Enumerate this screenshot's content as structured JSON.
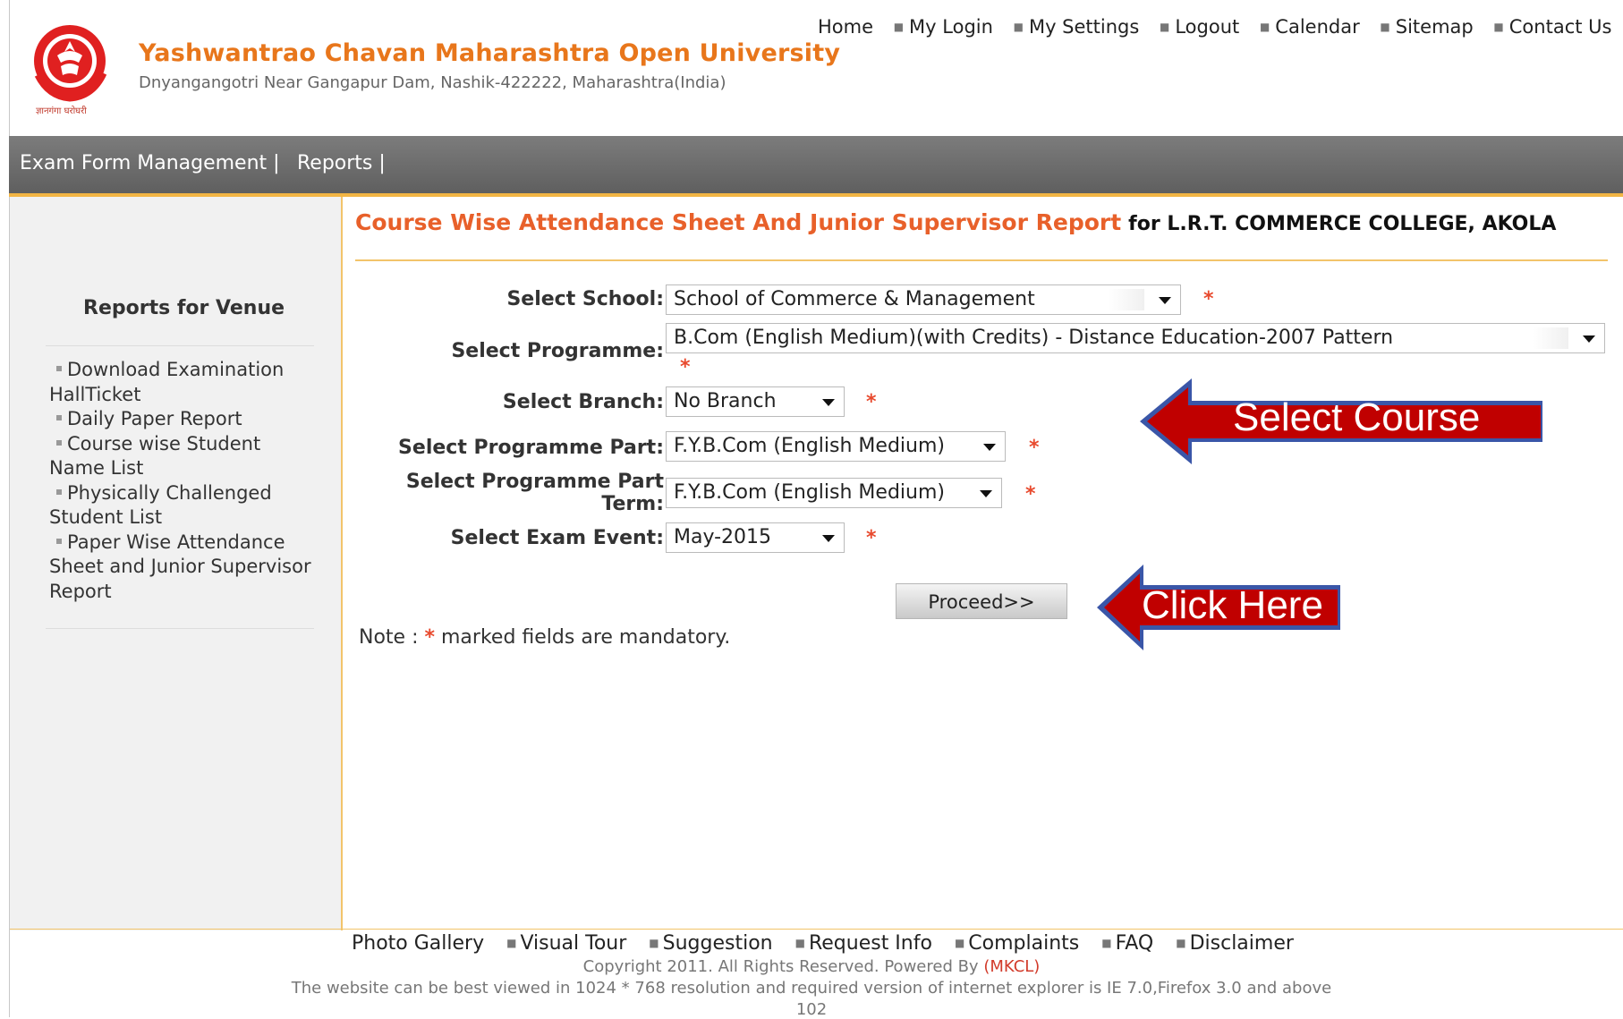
{
  "header": {
    "logo_caption": "ज्ञानगंगा घरोघरी",
    "university_name": "Yashwantrao Chavan Maharashtra Open University",
    "address": "Dnyangangotri Near Gangapur Dam, Nashik-422222, Maharashtra(India)"
  },
  "topnav": [
    "Home",
    "My Login",
    "My Settings",
    "Logout",
    "Calendar",
    "Sitemap",
    "Contact Us"
  ],
  "menubar": {
    "item1": "Exam Form Management |",
    "item2": "Reports |"
  },
  "sidebar": {
    "title": "Reports for Venue",
    "items": [
      "Download Examination HallTicket",
      "Daily Paper Report",
      "Course wise Student Name List",
      "Physically Challenged Student List",
      "Paper Wise Attendance Sheet and Junior Supervisor Report"
    ]
  },
  "page": {
    "title": "Course Wise Attendance Sheet And Junior Supervisor Report",
    "title_suffix": "for L.R.T. COMMERCE COLLEGE, AKOLA"
  },
  "form": {
    "school_label": "Select School:",
    "school_value": "School of Commerce & Management",
    "programme_label": "Select Programme:",
    "programme_value": "B.Com (English Medium)(with Credits) - Distance Education-2007 Pattern",
    "branch_label": "Select Branch:",
    "branch_value": "No Branch",
    "part_label": "Select Programme Part:",
    "part_value": "F.Y.B.Com (English Medium)",
    "term_label_line1": "Select Programme Part",
    "term_label_line2": "Term:",
    "term_value": "F.Y.B.Com (English Medium)",
    "event_label": "Select Exam Event:",
    "event_value": "May-2015",
    "required_mark": "*",
    "proceed_label": "Proceed>>",
    "note_prefix": "Note :",
    "note_star": "*",
    "note_text": "marked fields are mandatory."
  },
  "callouts": {
    "select_course": "Select Course",
    "click_here": "Click Here"
  },
  "footer": {
    "links": [
      "Photo Gallery",
      "Visual Tour",
      "Suggestion",
      "Request Info",
      "Complaints",
      "FAQ",
      "Disclaimer"
    ],
    "copyright": "Copyright 2011. All Rights Reserved. Powered By",
    "powered_by": "(MKCL)",
    "resolution_note": "The website can be best viewed in 1024 * 768 resolution and required version of internet explorer is IE 7.0,Firefox 3.0 and above",
    "counter": "102"
  },
  "colors": {
    "brand_orange": "#e8761b",
    "title_red": "#e8602a",
    "menubar_gray": "#6e6e6e",
    "accent_gold": "#f2b544",
    "callout_red": "#c00000"
  }
}
